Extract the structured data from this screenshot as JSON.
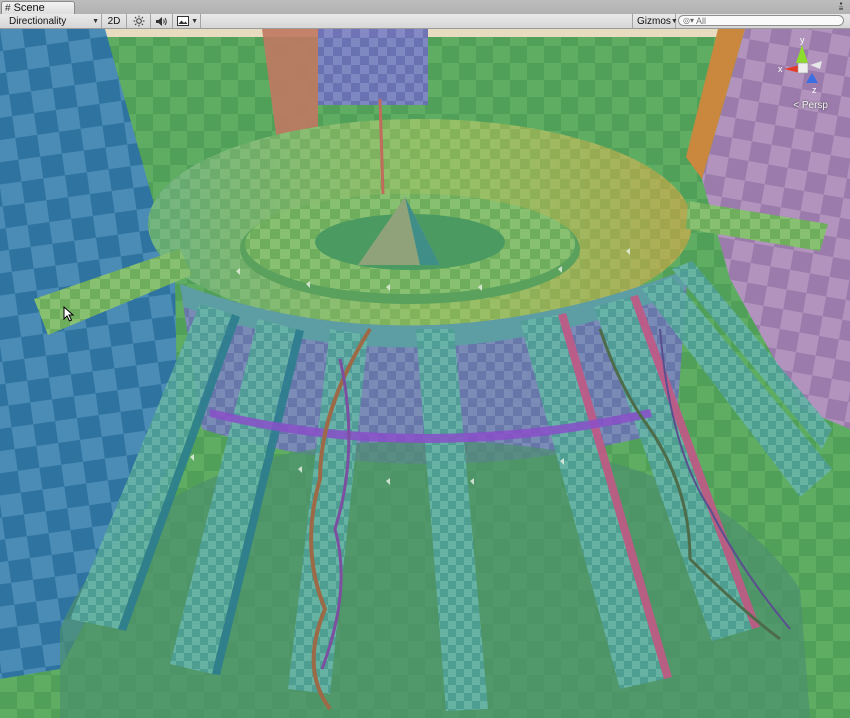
{
  "window": {
    "tab_label": "Scene",
    "tab_icon": "scene-icon"
  },
  "toolbar": {
    "draw_mode": "Directionality",
    "mode_2d": "2D",
    "lighting_icon": "sun-icon",
    "audio_icon": "speaker-icon",
    "effects_icon": "image-icon",
    "gizmos_label": "Gizmos",
    "search_placeholder": "All"
  },
  "scene_gizmo": {
    "axis_y": "y",
    "axis_x": "x",
    "axis_z": "z",
    "projection": "Persp"
  },
  "colors": {
    "axis_x": "#e53b2b",
    "axis_y": "#8ddb2a",
    "axis_z": "#3a6ee3",
    "ground": "#5aa360",
    "sky": "#e8dcc0"
  }
}
